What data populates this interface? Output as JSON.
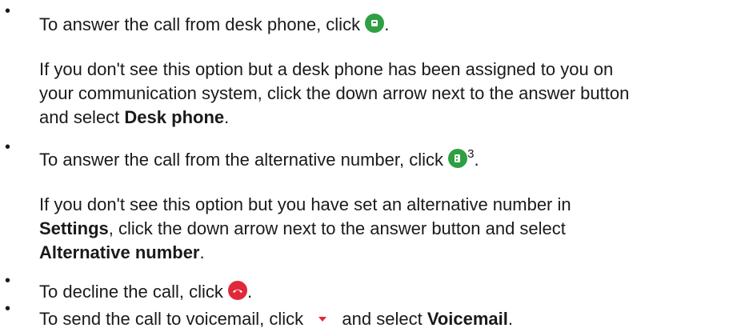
{
  "items": [
    {
      "text_before": "To answer the call from desk phone, click",
      "text_after": ".",
      "icon": "desk-phone-answer-icon",
      "note": {
        "line1": "If you don't see this option but a desk phone has been assigned to you on",
        "line2": "your communication system, click the down arrow next to the answer button",
        "line3_before": "and select",
        "line3_bold": "Desk phone",
        "line3_after": "."
      }
    },
    {
      "text_before": "To answer the call from the alternative number, click",
      "superscript": "3",
      "text_after": ".",
      "icon": "alternative-number-answer-icon",
      "note": {
        "line1": "If you don't see this option but you have set an alternative number in",
        "line2_bold": "Settings",
        "line2_after": ", click the down arrow next to the answer button and select",
        "line3_bold": "Alternative number",
        "line3_after": "."
      }
    },
    {
      "text_before": "To decline the call, click",
      "text_after": ".",
      "icon": "decline-call-icon"
    },
    {
      "text_before": "To send the call to voicemail, click",
      "text_middle": "and select",
      "text_bold": "Voicemail",
      "text_after": ".",
      "icon": "dropdown-arrow-icon"
    }
  ],
  "colors": {
    "answer_green": "#2ea043",
    "decline_red": "#e0293a",
    "arrow_red": "#e0293a"
  }
}
